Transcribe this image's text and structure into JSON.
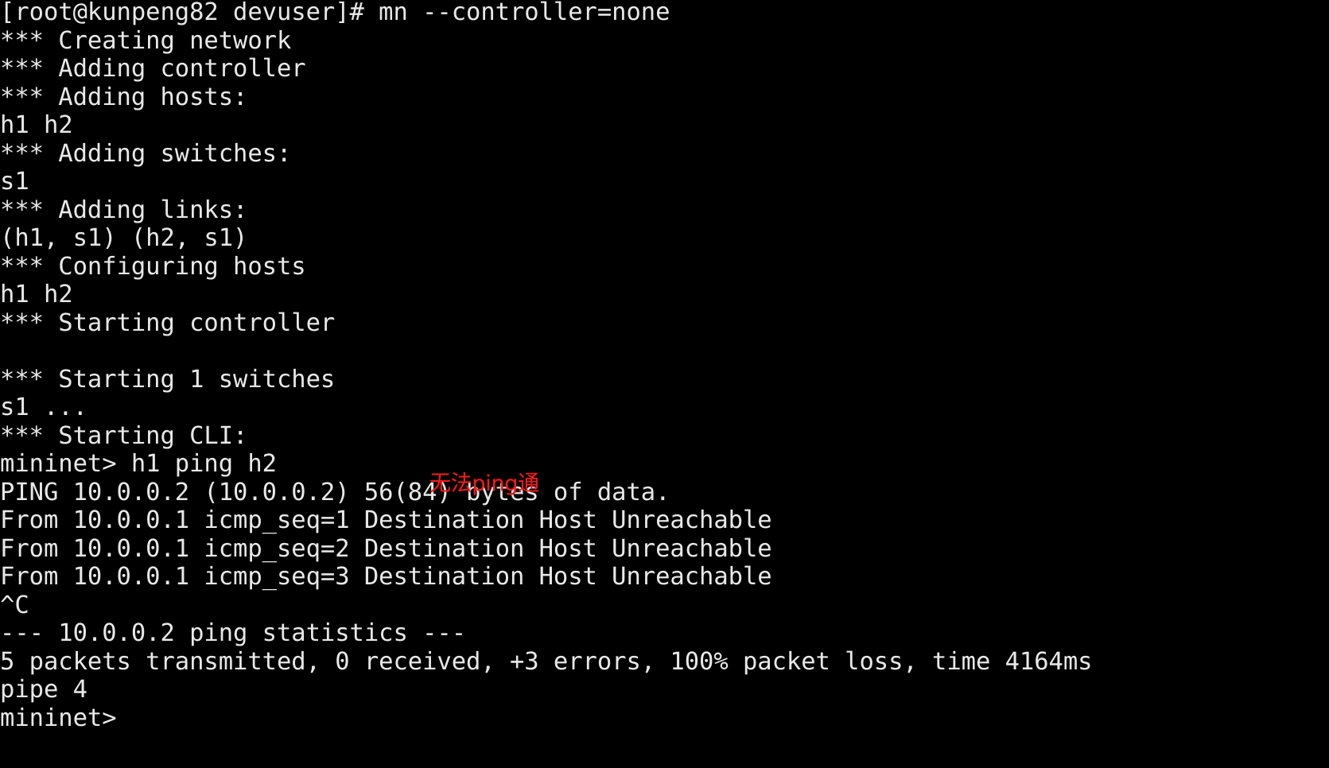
{
  "terminal": {
    "background_color": "#000000",
    "text_color": "#e8e8e8",
    "prompt_host": "[root@kunpeng82 devuser]#",
    "command": "mn --controller=none",
    "mininet_prompt": "mininet>",
    "lines": [
      "[root@kunpeng82 devuser]# mn --controller=none",
      "*** Creating network",
      "*** Adding controller",
      "*** Adding hosts:",
      "h1 h2",
      "*** Adding switches:",
      "s1",
      "*** Adding links:",
      "(h1, s1) (h2, s1)",
      "*** Configuring hosts",
      "h1 h2",
      "*** Starting controller",
      "",
      "*** Starting 1 switches",
      "s1 ...",
      "*** Starting CLI:",
      "mininet> h1 ping h2",
      "PING 10.0.0.2 (10.0.0.2) 56(84) bytes of data.",
      "From 10.0.0.1 icmp_seq=1 Destination Host Unreachable",
      "From 10.0.0.1 icmp_seq=2 Destination Host Unreachable",
      "From 10.0.0.1 icmp_seq=3 Destination Host Unreachable",
      "^C",
      "--- 10.0.0.2 ping statistics ---",
      "5 packets transmitted, 0 received, +3 errors, 100% packet loss, time 4164ms",
      "pipe 4",
      "mininet>"
    ]
  },
  "annotation": {
    "text": "无法ping通",
    "color": "#ef1b1b"
  }
}
